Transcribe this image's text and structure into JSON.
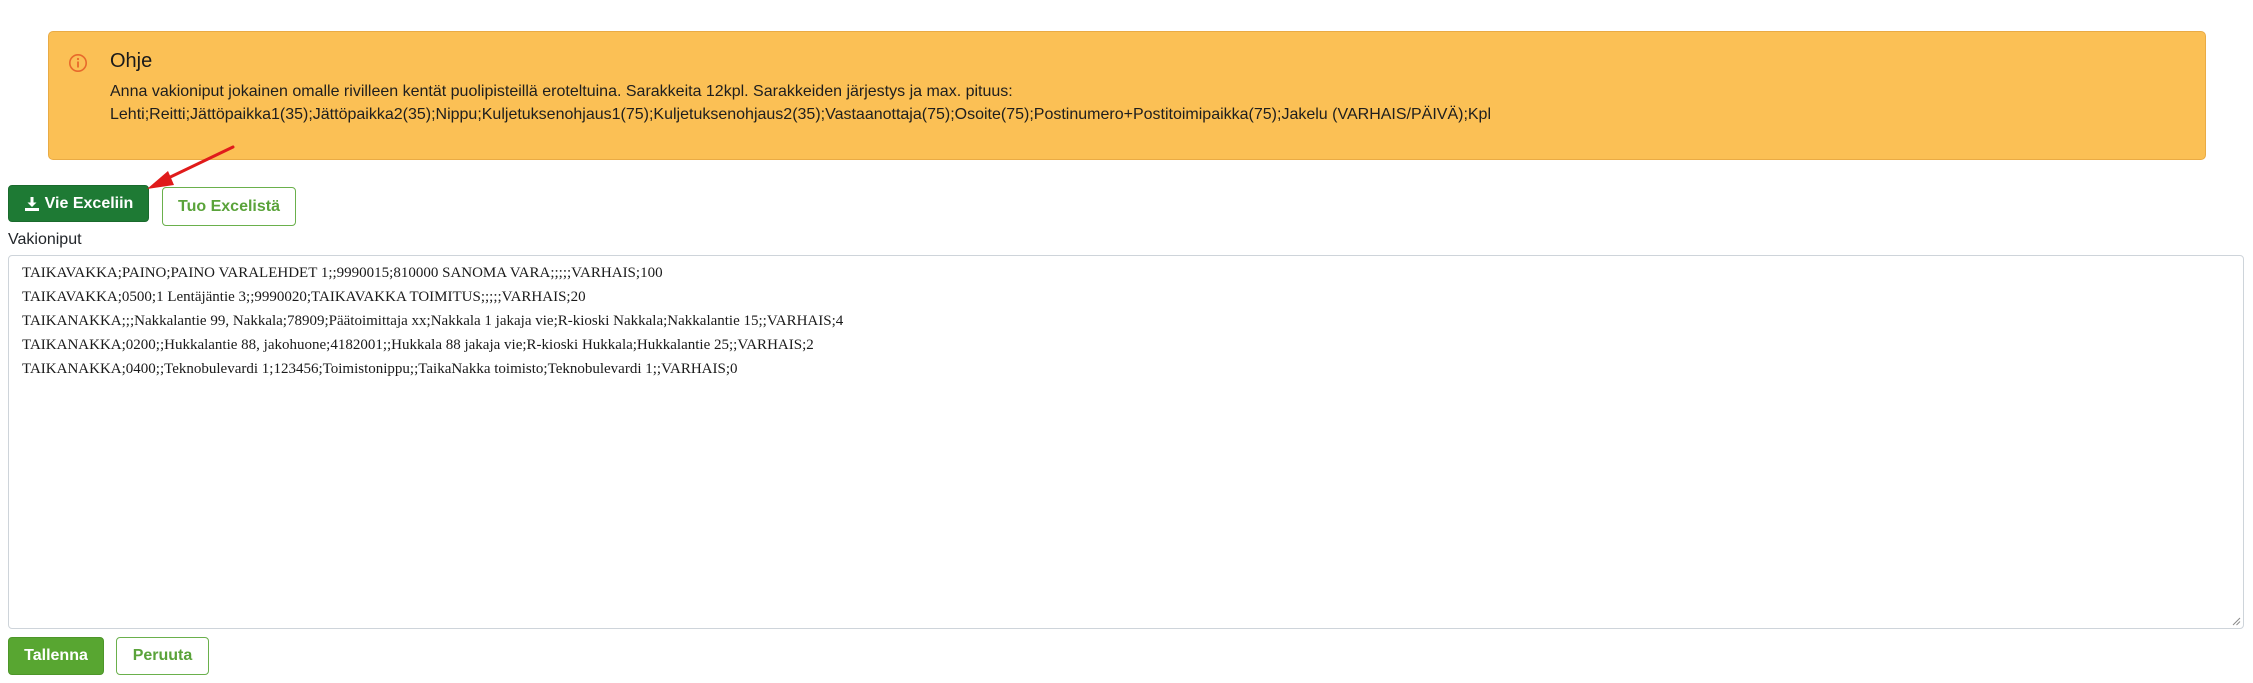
{
  "info": {
    "icon": "info-circle-icon",
    "title": "Ohje",
    "line1": "Anna vakioniput jokainen omalle rivilleen kentät puolipisteillä eroteltuina. Sarakkeita 12kpl. Sarakkeiden järjestys ja max. pituus:",
    "line2": "Lehti;Reitti;Jättöpaikka1(35);Jättöpaikka2(35);Nippu;Kuljetuksenohjaus1(75);Kuljetuksenohjaus2(35);Vastaanottaja(75);Osoite(75);Postinumero+Postitoimipaikka(75);Jakelu (VARHAIS/PÄIVÄ);Kpl",
    "background_color": "#fbc055",
    "icon_color": "#e8692b"
  },
  "toolbar": {
    "export_label": "Vie Exceliin",
    "export_icon": "download-icon",
    "import_label": "Tuo Excelistä"
  },
  "field": {
    "label": "Vakioniput",
    "lines": [
      "TAIKAVAKKA;PAINO;PAINO VARALEHDET 1;;9990015;810000 SANOMA VARA;;;;;VARHAIS;100",
      "TAIKAVAKKA;0500;1 Lentäjäntie 3;;9990020;TAIKAVAKKA TOIMITUS;;;;;VARHAIS;20",
      "TAIKANAKKA;;;Nakkalantie 99, Nakkala;78909;Päätoimittaja xx;Nakkala 1 jakaja vie;R-kioski Nakkala;Nakkalantie 15;;VARHAIS;4",
      "TAIKANAKKA;0200;;Hukkalantie 88, jakohuone;4182001;;Hukkala 88 jakaja vie;R-kioski Hukkala;Hukkalantie 25;;VARHAIS;2",
      "TAIKANAKKA;0400;;Teknobulevardi 1;123456;Toimistonippu;;TaikaNakka toimisto;Teknobulevardi 1;;VARHAIS;0"
    ]
  },
  "actions": {
    "save_label": "Tallenna",
    "cancel_label": "Peruuta"
  },
  "colors": {
    "primary_green": "#58a631",
    "dark_green": "#1e7a34",
    "outline_green": "#5aa33a",
    "annotation_red": "#e01b1b"
  }
}
